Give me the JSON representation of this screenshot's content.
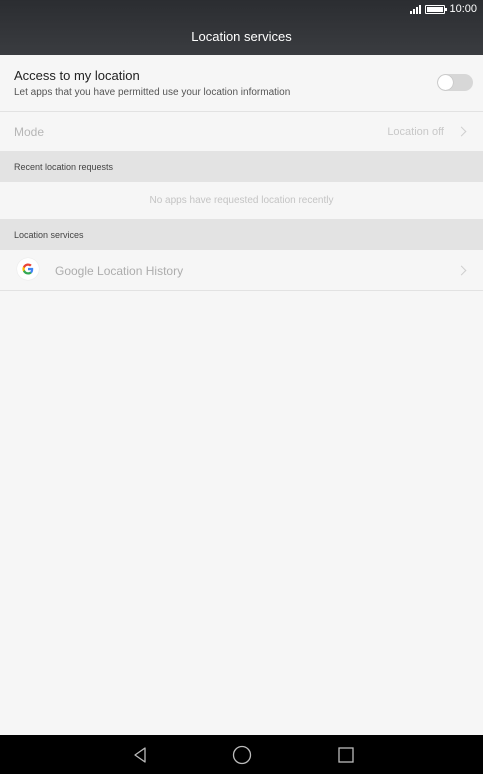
{
  "status_bar": {
    "time": "10:00",
    "icons": [
      "signal-icon",
      "battery-icon"
    ]
  },
  "header": {
    "title": "Location services"
  },
  "access": {
    "title": "Access to my location",
    "subtitle": "Let apps that you have permitted use your location information",
    "toggle_on": false
  },
  "mode": {
    "label": "Mode",
    "value": "Location off"
  },
  "recent": {
    "header": "Recent location requests",
    "empty_text": "No apps have requested location recently"
  },
  "services": {
    "header": "Location services",
    "items": [
      {
        "label": "Google Location History",
        "icon": "google-icon"
      }
    ]
  },
  "nav": {
    "buttons": [
      "back-icon",
      "home-icon",
      "recents-icon"
    ]
  },
  "colors": {
    "header_bg": "#2b2d31",
    "page_bg": "#f6f6f6",
    "section_bg": "#e3e3e3",
    "navbar_bg": "#000000"
  }
}
